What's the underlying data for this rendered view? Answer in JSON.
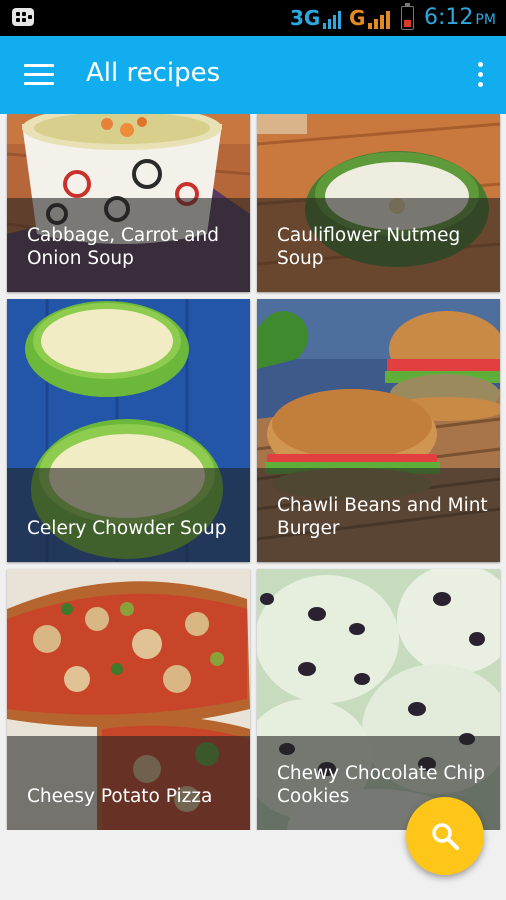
{
  "status_bar": {
    "network_1": "3G",
    "network_2": "G",
    "time": "6:12",
    "ampm": "PM",
    "icons": [
      "bbm-icon",
      "signal-icon",
      "battery-icon"
    ]
  },
  "app_bar": {
    "title": "All recipes",
    "background_color": "#11adef",
    "menu_icon": "hamburger-menu-icon",
    "overflow_icon": "more-vertical-icon"
  },
  "recipes": [
    {
      "title": "Cabbage, Carrot and Onion Soup"
    },
    {
      "title": "Cauliflower Nutmeg Soup"
    },
    {
      "title": "Celery Chowder Soup"
    },
    {
      "title": "Chawli Beans and Mint Burger"
    },
    {
      "title": "Cheesy Potato Pizza"
    },
    {
      "title": "Chewy Chocolate Chip Cookies"
    }
  ],
  "fab": {
    "icon": "search-icon",
    "color": "#ffc61a"
  }
}
